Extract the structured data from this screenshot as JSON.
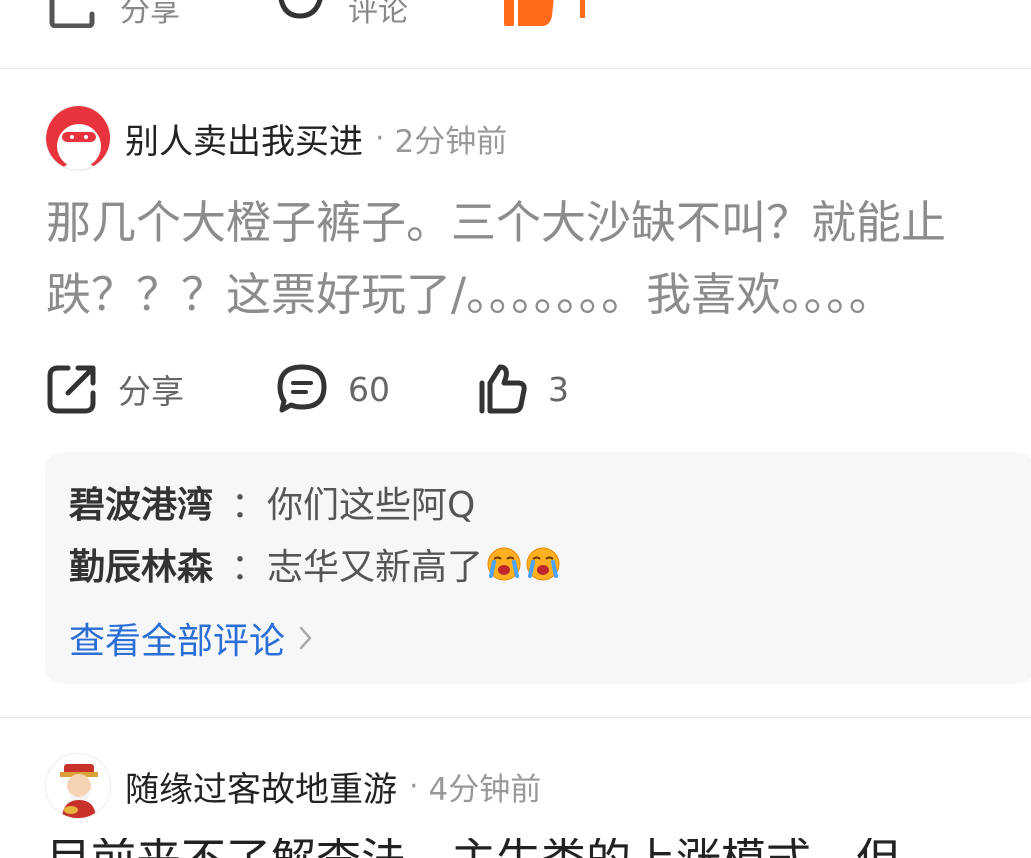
{
  "top_actions": {
    "share_label": "分享",
    "comment_label": "评论"
  },
  "post1": {
    "author": "别人卖出我买进",
    "separator": "·",
    "time": "2分钟前",
    "body_line1": "那几个大橙子裤子。三个大沙缺不叫？就能止",
    "body_line2": "跌？？？这票好玩了/。。。。。。。我喜欢。。。。",
    "actions": {
      "share_label": "分享",
      "comment_count": "60",
      "like_count": "3"
    },
    "comments": [
      {
        "user": "碧波港湾",
        "colon": "：",
        "text": "你们这些阿Q"
      },
      {
        "user": "勤辰林森",
        "colon": "：",
        "text": "志华又新高了"
      }
    ],
    "view_all": "查看全部评论",
    "view_all_chevron": ">"
  },
  "post2": {
    "author": "随缘过客故地重游",
    "separator": "·",
    "time": "4分钟前",
    "body_partial": "目前来不了解查法，主生类的上涨模式，但"
  },
  "colors": {
    "accent_orange": "#ff6a1a",
    "link_blue": "#2b6fd6",
    "avatar_red": "#e8323c"
  },
  "icons": [
    "share-icon",
    "comment-icon",
    "like-icon",
    "chevron-right-icon",
    "crying-emoji-icon"
  ]
}
